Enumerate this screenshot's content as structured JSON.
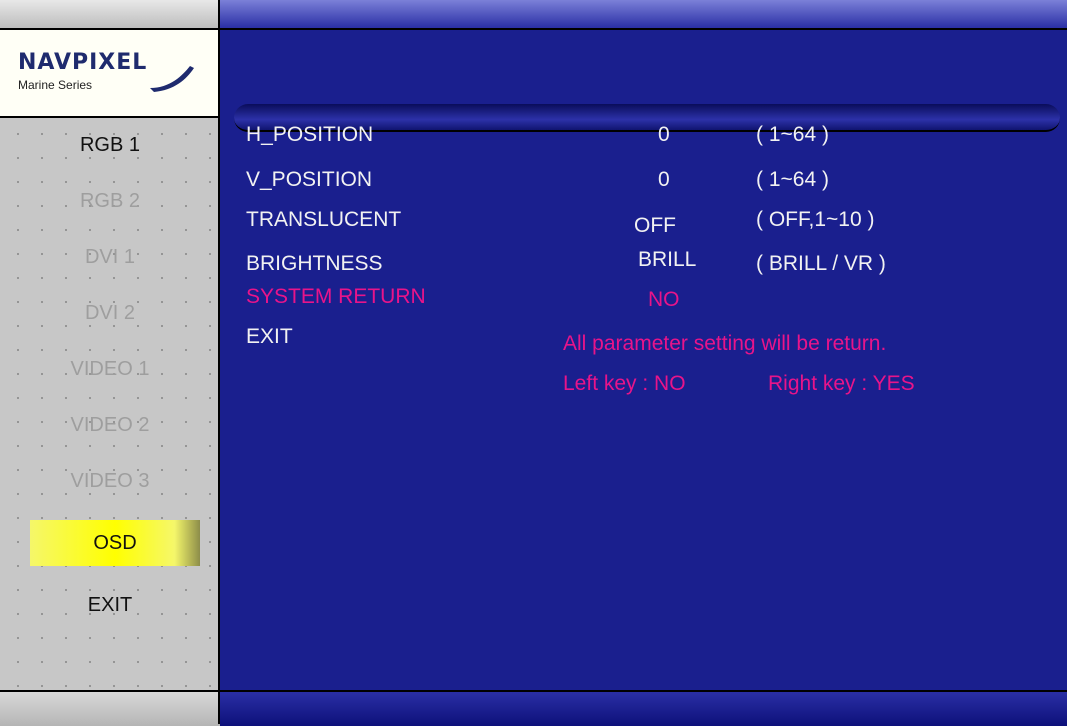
{
  "brand": {
    "name": "NAVPIXEL",
    "series": "Marine Series"
  },
  "menu": [
    {
      "label": "RGB 1",
      "state": "active"
    },
    {
      "label": "RGB 2",
      "state": "dim"
    },
    {
      "label": "DVI 1",
      "state": "dim"
    },
    {
      "label": "DVI 2",
      "state": "dim"
    },
    {
      "label": "VIDEO 1",
      "state": "dim"
    },
    {
      "label": "VIDEO 2",
      "state": "dim"
    },
    {
      "label": "VIDEO 3",
      "state": "dim"
    },
    {
      "label": "OSD",
      "state": "selected"
    },
    {
      "label": "EXIT",
      "state": "active"
    }
  ],
  "settings": [
    {
      "name": "H_POSITION",
      "value": "0",
      "range": "( 1~64 )"
    },
    {
      "name": "V_POSITION",
      "value": "0",
      "range": "( 1~64 )"
    },
    {
      "name": "TRANSLUCENT",
      "value": "OFF",
      "range": "( OFF,1~10 )"
    },
    {
      "name": "BRIGHTNESS",
      "value": "BRILL",
      "range": "( BRILL / VR )"
    },
    {
      "name": "SYSTEM RETURN",
      "value": "NO",
      "range": ""
    },
    {
      "name": "EXIT",
      "value": "",
      "range": ""
    }
  ],
  "message": {
    "line1": "All parameter setting will be return.",
    "left_key": "Left key : NO",
    "right_key": "Right key : YES"
  },
  "colors": {
    "background": "#1a1f8e",
    "highlight": "#e8148a",
    "selected_menu": "#ffff00"
  }
}
